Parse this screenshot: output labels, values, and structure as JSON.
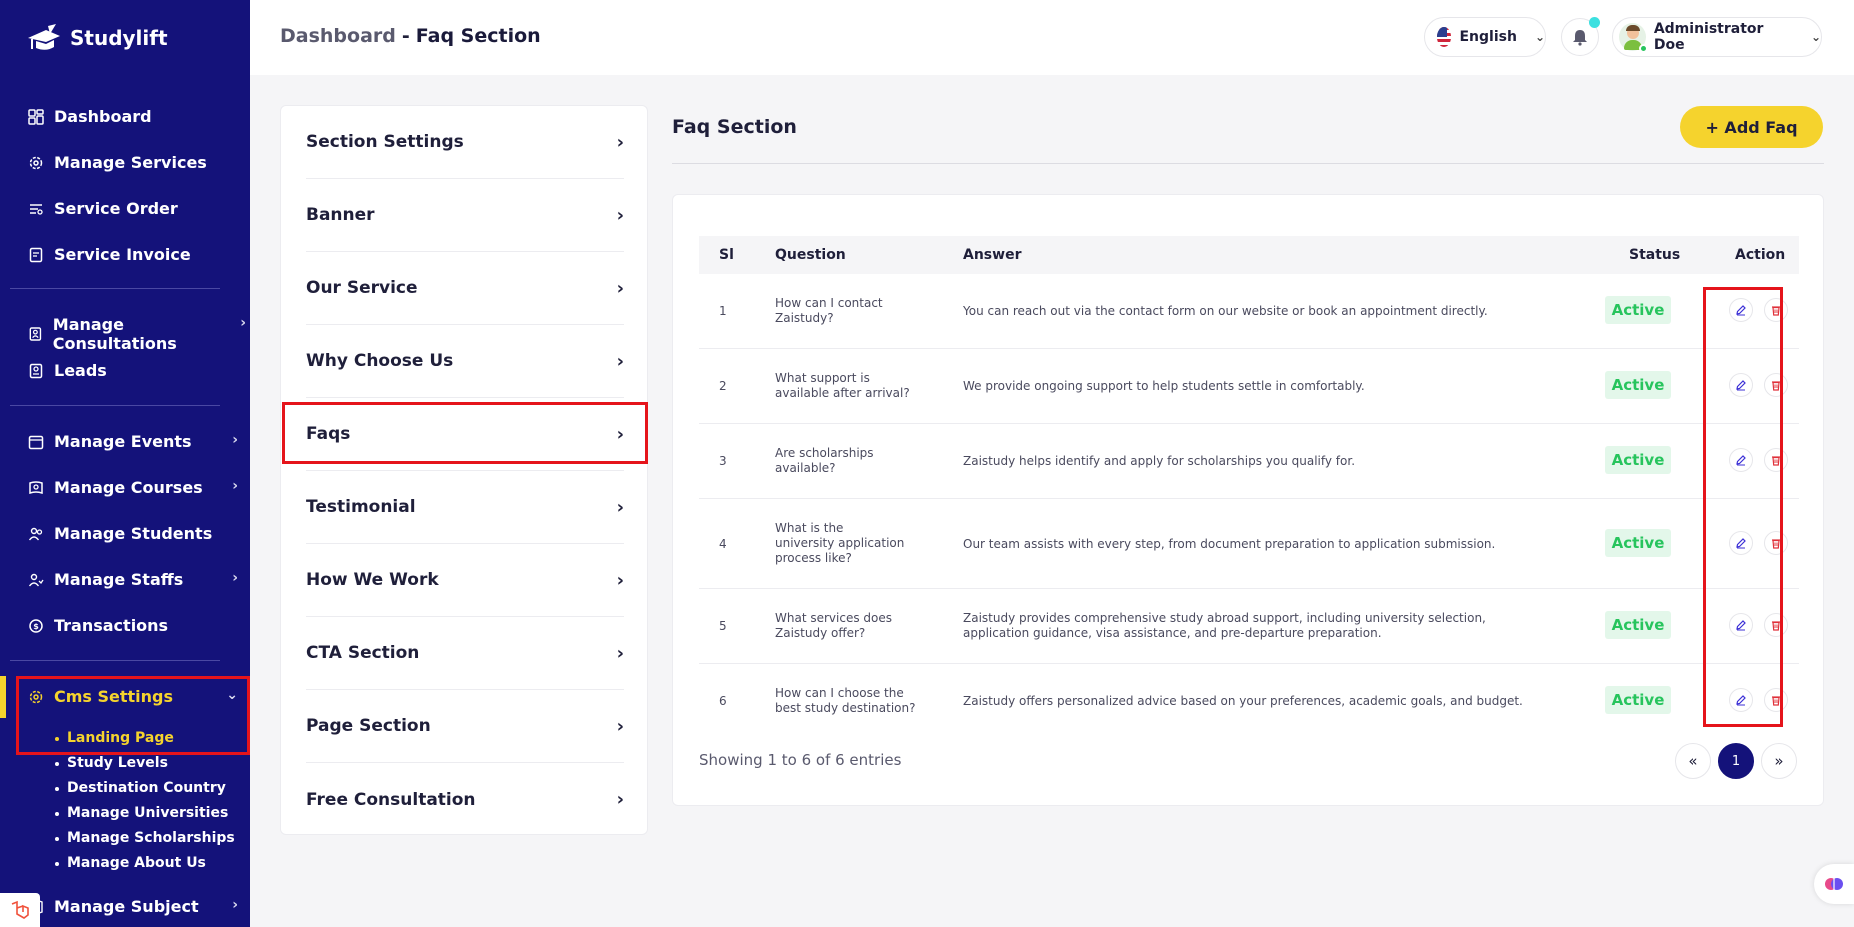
{
  "brand": {
    "name": "Studylift"
  },
  "sidebar": {
    "items": [
      {
        "label": "Dashboard",
        "icon": "dashboard-icon"
      },
      {
        "label": "Manage Services",
        "icon": "gear-icon"
      },
      {
        "label": "Service Order",
        "icon": "list-icon"
      },
      {
        "label": "Service Invoice",
        "icon": "invoice-icon"
      },
      {
        "label": "Manage Consultations",
        "icon": "consultation-icon"
      },
      {
        "label": "Leads",
        "icon": "leads-icon"
      },
      {
        "label": "Manage Events",
        "icon": "calendar-icon"
      },
      {
        "label": "Manage Courses",
        "icon": "courses-icon"
      },
      {
        "label": "Manage Students",
        "icon": "students-icon"
      },
      {
        "label": "Manage Staffs",
        "icon": "staffs-icon"
      },
      {
        "label": "Transactions",
        "icon": "transactions-icon"
      },
      {
        "label": "Cms Settings",
        "icon": "cms-icon"
      },
      {
        "label": "Manage Subject",
        "icon": "subject-icon"
      }
    ],
    "cms_submenu": [
      "Landing Page",
      "Study Levels",
      "Destination Country",
      "Manage Universities",
      "Manage Scholarships",
      "Manage About Us"
    ]
  },
  "header": {
    "breadcrumb_root": "Dashboard",
    "breadcrumb_sep": "-",
    "breadcrumb_current": "Faq Section",
    "language": "English",
    "user_name": "Administrator Doe"
  },
  "section_menu": [
    "Section Settings",
    "Banner",
    "Our Service",
    "Why Choose Us",
    "Faqs",
    "Testimonial",
    "How We Work",
    "CTA Section",
    "Page Section",
    "Free Consultation"
  ],
  "main": {
    "title": "Faq Section",
    "add_button": "+ Add Faq"
  },
  "table": {
    "headers": {
      "sl": "Sl",
      "question": "Question",
      "answer": "Answer",
      "status": "Status",
      "action": "Action"
    },
    "rows": [
      {
        "sl": "1",
        "question": "How can I contact Zaistudy?",
        "answer": "You can reach out via the contact form on our website or book an appointment directly.",
        "status": "Active"
      },
      {
        "sl": "2",
        "question": "What support is available after arrival?",
        "answer": "We provide ongoing support to help students settle in comfortably.",
        "status": "Active"
      },
      {
        "sl": "3",
        "question": "Are scholarships available?",
        "answer": "Zaistudy helps identify and apply for scholarships you qualify for.",
        "status": "Active"
      },
      {
        "sl": "4",
        "question": "What is the university application process like?",
        "answer": "Our team assists with every step, from document preparation to application submission.",
        "status": "Active"
      },
      {
        "sl": "5",
        "question": "What services does Zaistudy offer?",
        "answer": "Zaistudy provides comprehensive study abroad support, including university selection, application guidance, visa assistance, and pre-departure preparation.",
        "status": "Active"
      },
      {
        "sl": "6",
        "question": "How can I choose the best study destination?",
        "answer": "Zaistudy offers personalized advice based on your preferences, academic goals, and budget.",
        "status": "Active"
      }
    ],
    "footer": "Showing 1 to 6 of 6 entries",
    "pagination": {
      "prev": "«",
      "page": "1",
      "next": "»"
    }
  },
  "colors": {
    "sidebar_bg": "#14127a",
    "accent_yellow": "#f5d32d",
    "highlight_red": "#e5141b",
    "status_green": "#27c45d",
    "edit_icon": "#3b2fd6",
    "delete_icon": "#e0313a"
  }
}
